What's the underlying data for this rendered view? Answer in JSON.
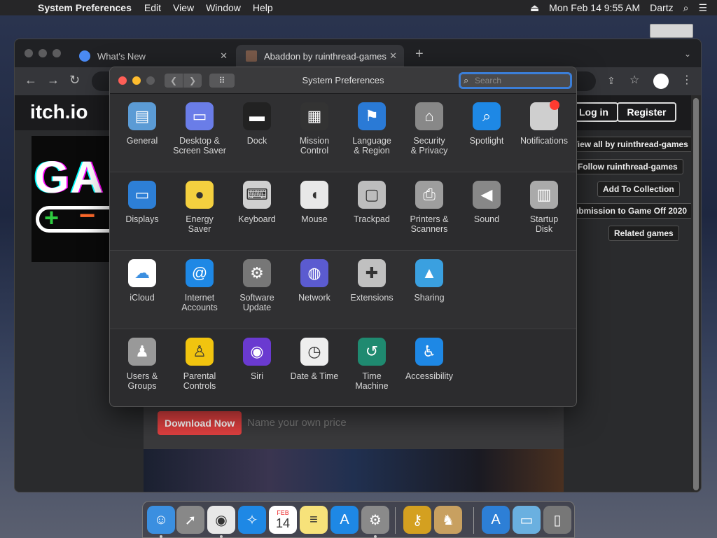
{
  "menubar": {
    "app_name": "System Preferences",
    "menus": [
      "Edit",
      "View",
      "Window",
      "Help"
    ],
    "datetime": "Mon Feb 14  9:55 AM",
    "user": "Dartz"
  },
  "browser": {
    "tabs": [
      {
        "title": "What's New"
      },
      {
        "title": "Abaddon by ruinthread-games"
      }
    ],
    "page": {
      "logo": "itch.io",
      "login": "Log in",
      "register": "Register",
      "side_buttons": [
        "View all by ruinthread-games",
        "Follow ruinthread-games",
        "Add To Collection",
        "Submission to Game Off 2020",
        "Related games"
      ],
      "banner_text": "GA",
      "download_button": "Download Now",
      "price_hint": "Name your own price"
    }
  },
  "syspref": {
    "title": "System Preferences",
    "search_placeholder": "Search",
    "rows": [
      [
        {
          "label": "General",
          "icon": "general-icon",
          "color": "#5b9bd5"
        },
        {
          "label": "Desktop &\nScreen Saver",
          "icon": "desktop-icon",
          "color": "#6a7de8"
        },
        {
          "label": "Dock",
          "icon": "dock-icon",
          "color": "#222"
        },
        {
          "label": "Mission\nControl",
          "icon": "mission-control-icon",
          "color": "#333"
        },
        {
          "label": "Language\n& Region",
          "icon": "flag-icon",
          "color": "#2a7ad6"
        },
        {
          "label": "Security\n& Privacy",
          "icon": "house-lock-icon",
          "color": "#888"
        },
        {
          "label": "Spotlight",
          "icon": "magnifier-icon",
          "color": "#1e88e5"
        },
        {
          "label": "Notifications",
          "icon": "notifications-icon",
          "color": "#cfcfcf"
        }
      ],
      [
        {
          "label": "Displays",
          "icon": "display-icon",
          "color": "#2d7fd6"
        },
        {
          "label": "Energy\nSaver",
          "icon": "lightbulb-icon",
          "color": "#f4d03f"
        },
        {
          "label": "Keyboard",
          "icon": "keyboard-icon",
          "color": "#d0d0d0"
        },
        {
          "label": "Mouse",
          "icon": "mouse-icon",
          "color": "#e8e8e8"
        },
        {
          "label": "Trackpad",
          "icon": "trackpad-icon",
          "color": "#bdbdbd"
        },
        {
          "label": "Printers &\nScanners",
          "icon": "printer-icon",
          "color": "#9e9e9e"
        },
        {
          "label": "Sound",
          "icon": "speaker-icon",
          "color": "#888"
        },
        {
          "label": "Startup\nDisk",
          "icon": "disk-icon",
          "color": "#aaa"
        }
      ],
      [
        {
          "label": "iCloud",
          "icon": "cloud-icon",
          "color": "#ffffff"
        },
        {
          "label": "Internet\nAccounts",
          "icon": "at-icon",
          "color": "#1e88e5"
        },
        {
          "label": "Software\nUpdate",
          "icon": "gear-icon",
          "color": "#777"
        },
        {
          "label": "Network",
          "icon": "globe-icon",
          "color": "#5b5bd0"
        },
        {
          "label": "Extensions",
          "icon": "puzzle-icon",
          "color": "#c0c0c0"
        },
        {
          "label": "Sharing",
          "icon": "folder-sign-icon",
          "color": "#3aa0e0"
        }
      ],
      [
        {
          "label": "Users &\nGroups",
          "icon": "users-icon",
          "color": "#999"
        },
        {
          "label": "Parental\nControls",
          "icon": "parental-icon",
          "color": "#f1c40f"
        },
        {
          "label": "Siri",
          "icon": "siri-icon",
          "color": "#6a3ad0"
        },
        {
          "label": "Date & Time",
          "icon": "clock-icon",
          "color": "#eee"
        },
        {
          "label": "Time\nMachine",
          "icon": "time-machine-icon",
          "color": "#1f8a70"
        },
        {
          "label": "Accessibility",
          "icon": "accessibility-icon",
          "color": "#1e88e5"
        }
      ]
    ]
  },
  "dock": {
    "apps": [
      {
        "name": "finder-icon",
        "color": "#3b8fe0"
      },
      {
        "name": "launchpad-icon",
        "color": "#888"
      },
      {
        "name": "chrome-icon",
        "color": "#e8e8e8"
      },
      {
        "name": "safari-icon",
        "color": "#1e88e5"
      },
      {
        "name": "calendar-icon",
        "color": "#ffffff"
      },
      {
        "name": "notes-icon",
        "color": "#f7e27a"
      },
      {
        "name": "app-store-icon",
        "color": "#1e88e5"
      },
      {
        "name": "system-preferences-icon",
        "color": "#8a8a8a"
      },
      {
        "name": "keychain-icon",
        "color": "#d4a020"
      },
      {
        "name": "chess-icon",
        "color": "#c8a060"
      },
      {
        "name": "app-store-folder-icon",
        "color": "#2d7fd6"
      },
      {
        "name": "downloads-folder-icon",
        "color": "#6ab0e0"
      },
      {
        "name": "trash-icon",
        "color": "#777"
      }
    ],
    "calendar": {
      "month": "FEB",
      "day": "14"
    }
  }
}
